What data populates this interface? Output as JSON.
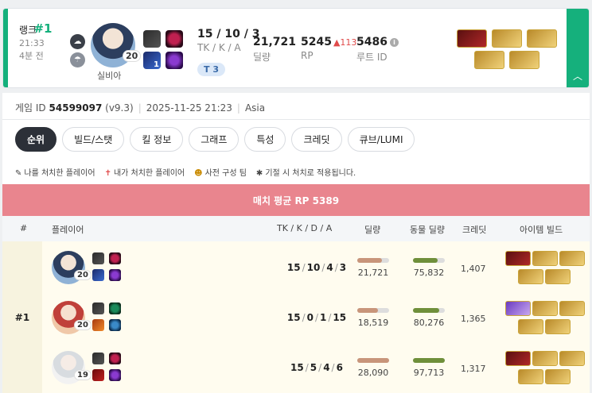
{
  "summary": {
    "rank_num": "#1",
    "rank_label": "랭크",
    "time": "21:33",
    "duration": "4분 전",
    "character_level": "20",
    "character_name": "실비아",
    "kda": "15 / 10 / 3",
    "kda_label": "TK / K / A",
    "tier": "T 3",
    "damage": "21,721",
    "damage_label": "딜량",
    "rp": "5245",
    "rp_change": "▲113",
    "rp_label": "RP",
    "route_id": "5486",
    "route_label": "루트 ID",
    "collapse_icon": "chevron-up-icon"
  },
  "meta": {
    "game_id_label": "게임 ID",
    "game_id": "54599097",
    "version": "(v9.3)",
    "datetime": "2025-11-25 21:23",
    "region": "Asia"
  },
  "tabs": [
    "순위",
    "빌드/스탯",
    "킬 정보",
    "그래프",
    "특성",
    "크레딧",
    "큐브/LUMI"
  ],
  "legend": [
    {
      "icon": "✎",
      "text": "나를 처치한 플레이어"
    },
    {
      "icon": "✝",
      "text": "내가 처치한 플레이어"
    },
    {
      "icon": "☻",
      "text": "사전 구성 팀"
    },
    {
      "icon": "✱",
      "text": "기절 시 처치로 적용됩니다."
    }
  ],
  "banner": "매치 평균 RP 5389",
  "table": {
    "headers": [
      "#",
      "플레이어",
      "TK / K / D / A",
      "딜량",
      "동물 딜량",
      "크레딧",
      "아이템 빌드"
    ],
    "team_rank": "#1",
    "rows": [
      {
        "level": "20",
        "kda": [
          "15",
          "10",
          "4",
          "3"
        ],
        "damage": "21,721",
        "damage_frac": 0.78,
        "animal": "75,832",
        "animal_frac": 0.78,
        "credit": "1,407"
      },
      {
        "level": "20",
        "kda": [
          "15",
          "0",
          "1",
          "15"
        ],
        "damage": "18,519",
        "damage_frac": 0.66,
        "animal": "80,276",
        "animal_frac": 0.82,
        "credit": "1,365"
      },
      {
        "level": "19",
        "kda": [
          "15",
          "5",
          "4",
          "6"
        ],
        "damage": "28,090",
        "damage_frac": 1.0,
        "animal": "97,713",
        "animal_frac": 1.0,
        "credit": "1,317"
      }
    ]
  },
  "colors": {
    "accent": "#15b07c",
    "banner": "#e9858e",
    "damage_bar": "#c8957a",
    "animal_bar": "#6f8f3a",
    "rp_up": "#e04a4a"
  }
}
